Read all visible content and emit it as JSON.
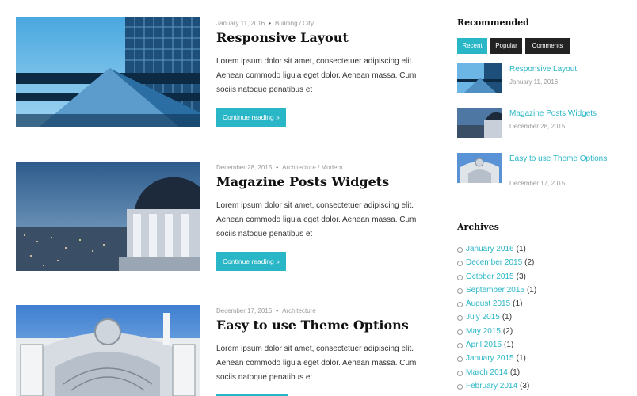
{
  "posts": [
    {
      "date": "January 11, 2016",
      "category": "Building / City",
      "title": "Responsive Layout",
      "excerpt": "Lorem ipsum dolor sit amet, consectetuer adipiscing elit. Aenean commodo ligula eget dolor. Aenean massa. Cum sociis natoque penatibus et",
      "button": "Continue reading »"
    },
    {
      "date": "December 28, 2015",
      "category": "Architecture / Modern",
      "title": "Magazine Posts Widgets",
      "excerpt": "Lorem ipsum dolor sit amet, consectetuer adipiscing elit. Aenean commodo ligula eget dolor. Aenean massa. Cum sociis natoque penatibus et",
      "button": "Continue reading »"
    },
    {
      "date": "December 17, 2015",
      "category": "Architecture",
      "title": "Easy to use Theme Options",
      "excerpt": "Lorem ipsum dolor sit amet, consectetuer adipiscing elit. Aenean commodo ligula eget dolor. Aenean massa. Cum sociis natoque penatibus et"
    }
  ],
  "sidebar": {
    "recommended_heading": "Recommended",
    "tabs": [
      "Recent",
      "Popular",
      "Comments"
    ],
    "recent": [
      {
        "title": "Responsive Layout",
        "date": "January 11, 2016"
      },
      {
        "title": "Magazine Posts Widgets",
        "date": "December 28, 2015"
      },
      {
        "title": "Easy to use Theme Options",
        "date": "December 17, 2015"
      }
    ],
    "archives_heading": "Archives",
    "archives": [
      {
        "label": "January 2016",
        "count": "(1)"
      },
      {
        "label": "December 2015",
        "count": "(2)"
      },
      {
        "label": "October 2015",
        "count": "(3)"
      },
      {
        "label": "September 2015",
        "count": "(1)"
      },
      {
        "label": "August 2015",
        "count": "(1)"
      },
      {
        "label": "July 2015",
        "count": "(1)"
      },
      {
        "label": "May 2015",
        "count": "(2)"
      },
      {
        "label": "April 2015",
        "count": "(1)"
      },
      {
        "label": "January 2015",
        "count": "(1)"
      },
      {
        "label": "March 2014",
        "count": "(1)"
      },
      {
        "label": "February 2014",
        "count": "(3)"
      }
    ]
  },
  "colors": {
    "accent": "#29b6c6",
    "tab_inactive": "#222222",
    "text": "#333333",
    "meta": "#999999"
  }
}
